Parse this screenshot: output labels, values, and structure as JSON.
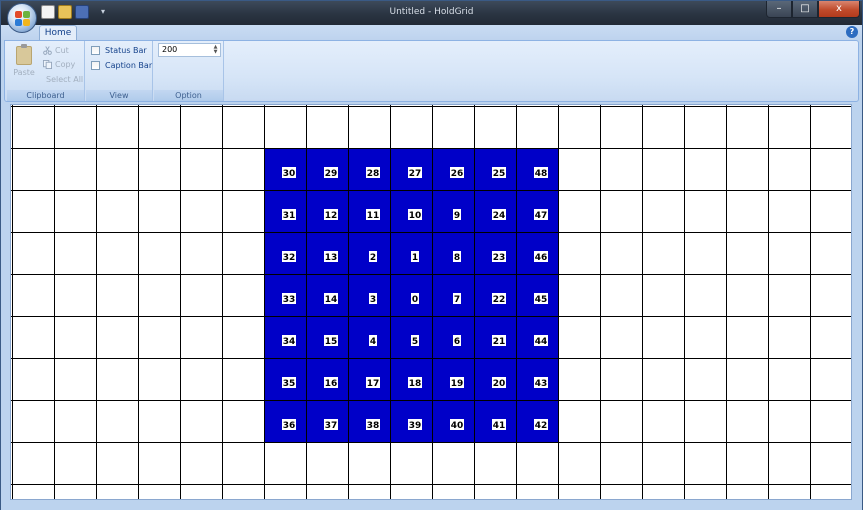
{
  "window": {
    "title": "Untitled - HoldGrid",
    "controls": {
      "minimize": "–",
      "maximize": "□",
      "close": "x"
    }
  },
  "quick_access": {
    "icons": [
      "new-document-icon",
      "open-folder-icon",
      "save-disk-icon"
    ],
    "customize": "▾"
  },
  "ribbon": {
    "tabs": [
      {
        "label": "Home",
        "active": true
      }
    ],
    "help": "?",
    "groups": {
      "clipboard": {
        "label": "Clipboard",
        "paste": "Paste",
        "cut": "Cut",
        "copy": "Copy",
        "select_all": "Select All",
        "enabled": false
      },
      "view": {
        "label": "View",
        "status_bar": {
          "label": "Status Bar",
          "checked": false
        },
        "caption_bar": {
          "label": "Caption Bar",
          "checked": false
        }
      },
      "option": {
        "label": "Option",
        "spin_value": "200"
      }
    }
  },
  "grid": {
    "columns": 20,
    "rows": 10,
    "block": {
      "color": "#0000c8",
      "col_start": 6,
      "row_start": 1,
      "cols": 7,
      "rows": 7,
      "numbers": [
        [
          "30",
          "29",
          "28",
          "27",
          "26",
          "25",
          "48"
        ],
        [
          "31",
          "12",
          "11",
          "10",
          "9",
          "24",
          "47"
        ],
        [
          "32",
          "13",
          "2",
          "1",
          "8",
          "23",
          "46"
        ],
        [
          "33",
          "14",
          "3",
          "0",
          "7",
          "22",
          "45"
        ],
        [
          "34",
          "15",
          "4",
          "5",
          "6",
          "21",
          "44"
        ],
        [
          "35",
          "16",
          "17",
          "18",
          "19",
          "20",
          "43"
        ],
        [
          "36",
          "37",
          "38",
          "39",
          "40",
          "41",
          "42"
        ]
      ]
    }
  },
  "colors": {
    "grid_line": "#000000",
    "block": "#0000c8",
    "label_bg": "#ffffff",
    "label_text": "#000000"
  }
}
